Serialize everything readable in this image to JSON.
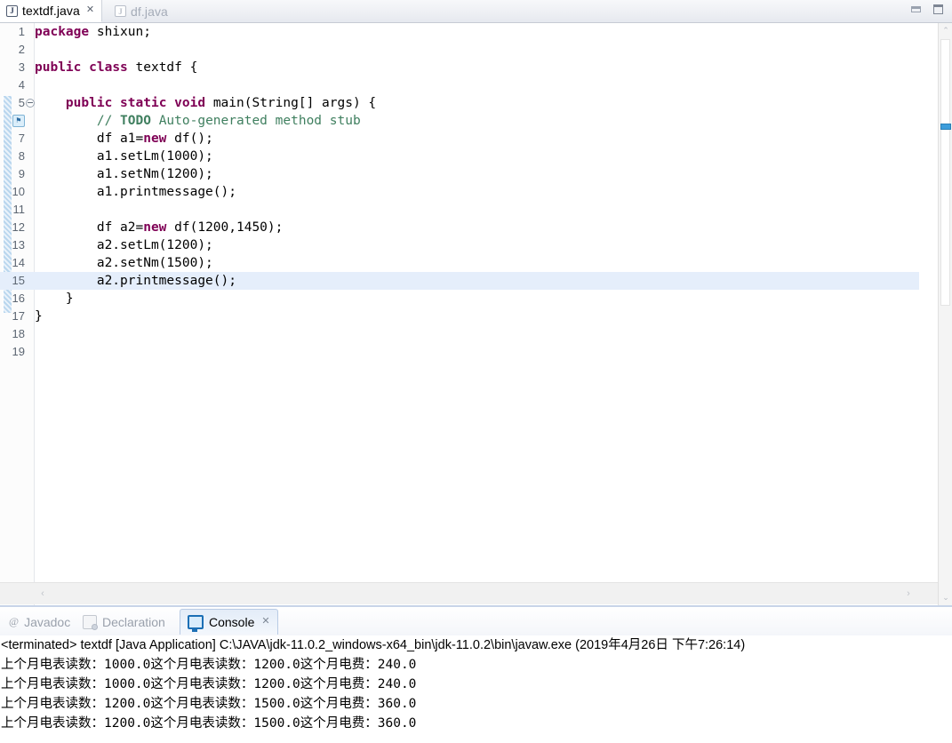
{
  "editor": {
    "tabs": [
      {
        "label": "textdf.java",
        "icon": "java-file-icon",
        "active": true,
        "close": "✕"
      },
      {
        "label": "df.java",
        "icon": "java-file-icon",
        "active": false
      }
    ],
    "window_buttons": {
      "minimize": "minimize-icon",
      "maximize": "maximize-icon"
    },
    "lines": [
      {
        "n": "1",
        "html": "<span class='kw'>package</span> shixun;"
      },
      {
        "n": "2",
        "html": ""
      },
      {
        "n": "3",
        "html": "<span class='kw'>public</span> <span class='kw'>class</span> textdf {"
      },
      {
        "n": "4",
        "html": ""
      },
      {
        "n": "5",
        "html": "    <span class='kw'>public</span> <span class='kw'>static</span> <span class='kw'>void</span> main(String[] args) {",
        "fold": true
      },
      {
        "n": "6",
        "html": "        <span class='cmt'>// <b>TODO</b> Auto-generated method stub</span>",
        "bulb": true
      },
      {
        "n": "7",
        "html": "        df a1=<span class='kw'>new</span> df();"
      },
      {
        "n": "8",
        "html": "        a1.setLm(1000);"
      },
      {
        "n": "9",
        "html": "        a1.setNm(1200);"
      },
      {
        "n": "10",
        "html": "        a1.printmessage();"
      },
      {
        "n": "11",
        "html": ""
      },
      {
        "n": "12",
        "html": "        df a2=<span class='kw'>new</span> df(1200,1450);"
      },
      {
        "n": "13",
        "html": "        a2.setLm(1200);"
      },
      {
        "n": "14",
        "html": "        a2.setNm(1500);"
      },
      {
        "n": "15",
        "html": "        a2.printmessage();",
        "current": true
      },
      {
        "n": "16",
        "html": "    }"
      },
      {
        "n": "17",
        "html": "}"
      },
      {
        "n": "18",
        "html": ""
      },
      {
        "n": "19",
        "html": ""
      }
    ],
    "scroll": {
      "up_arrow": "chevron-up-icon",
      "down_arrow": "chevron-down-icon",
      "left_arrow": "chevron-left-icon",
      "right_arrow": "chevron-right-icon"
    }
  },
  "bottom_panel": {
    "tabs": [
      {
        "label": "Javadoc",
        "icon": "at-icon",
        "active": false
      },
      {
        "label": "Declaration",
        "icon": "declaration-icon",
        "active": false
      },
      {
        "label": "Console",
        "icon": "console-icon",
        "active": true,
        "close": "✕"
      }
    ],
    "console": {
      "header": "<terminated> textdf [Java Application] C:\\JAVA\\jdk-11.0.2_windows-x64_bin\\jdk-11.0.2\\bin\\javaw.exe (2019年4月26日 下午7:26:14)",
      "output": [
        "上个月电表读数：1000.0这个月电表读数：1200.0这个月电费：240.0",
        "上个月电表读数：1000.0这个月电表读数：1200.0这个月电费：240.0",
        "上个月电表读数：1200.0这个月电表读数：1500.0这个月电费：360.0",
        "上个月电表读数：1200.0这个月电表读数：1500.0这个月电费：360.0"
      ]
    }
  },
  "colors": {
    "keyword": "#7f0055",
    "comment": "#3f7f5f",
    "current_line": "#e5eefb",
    "marker": "#3c9ddb",
    "tab_active_bg": "#ffffff"
  }
}
